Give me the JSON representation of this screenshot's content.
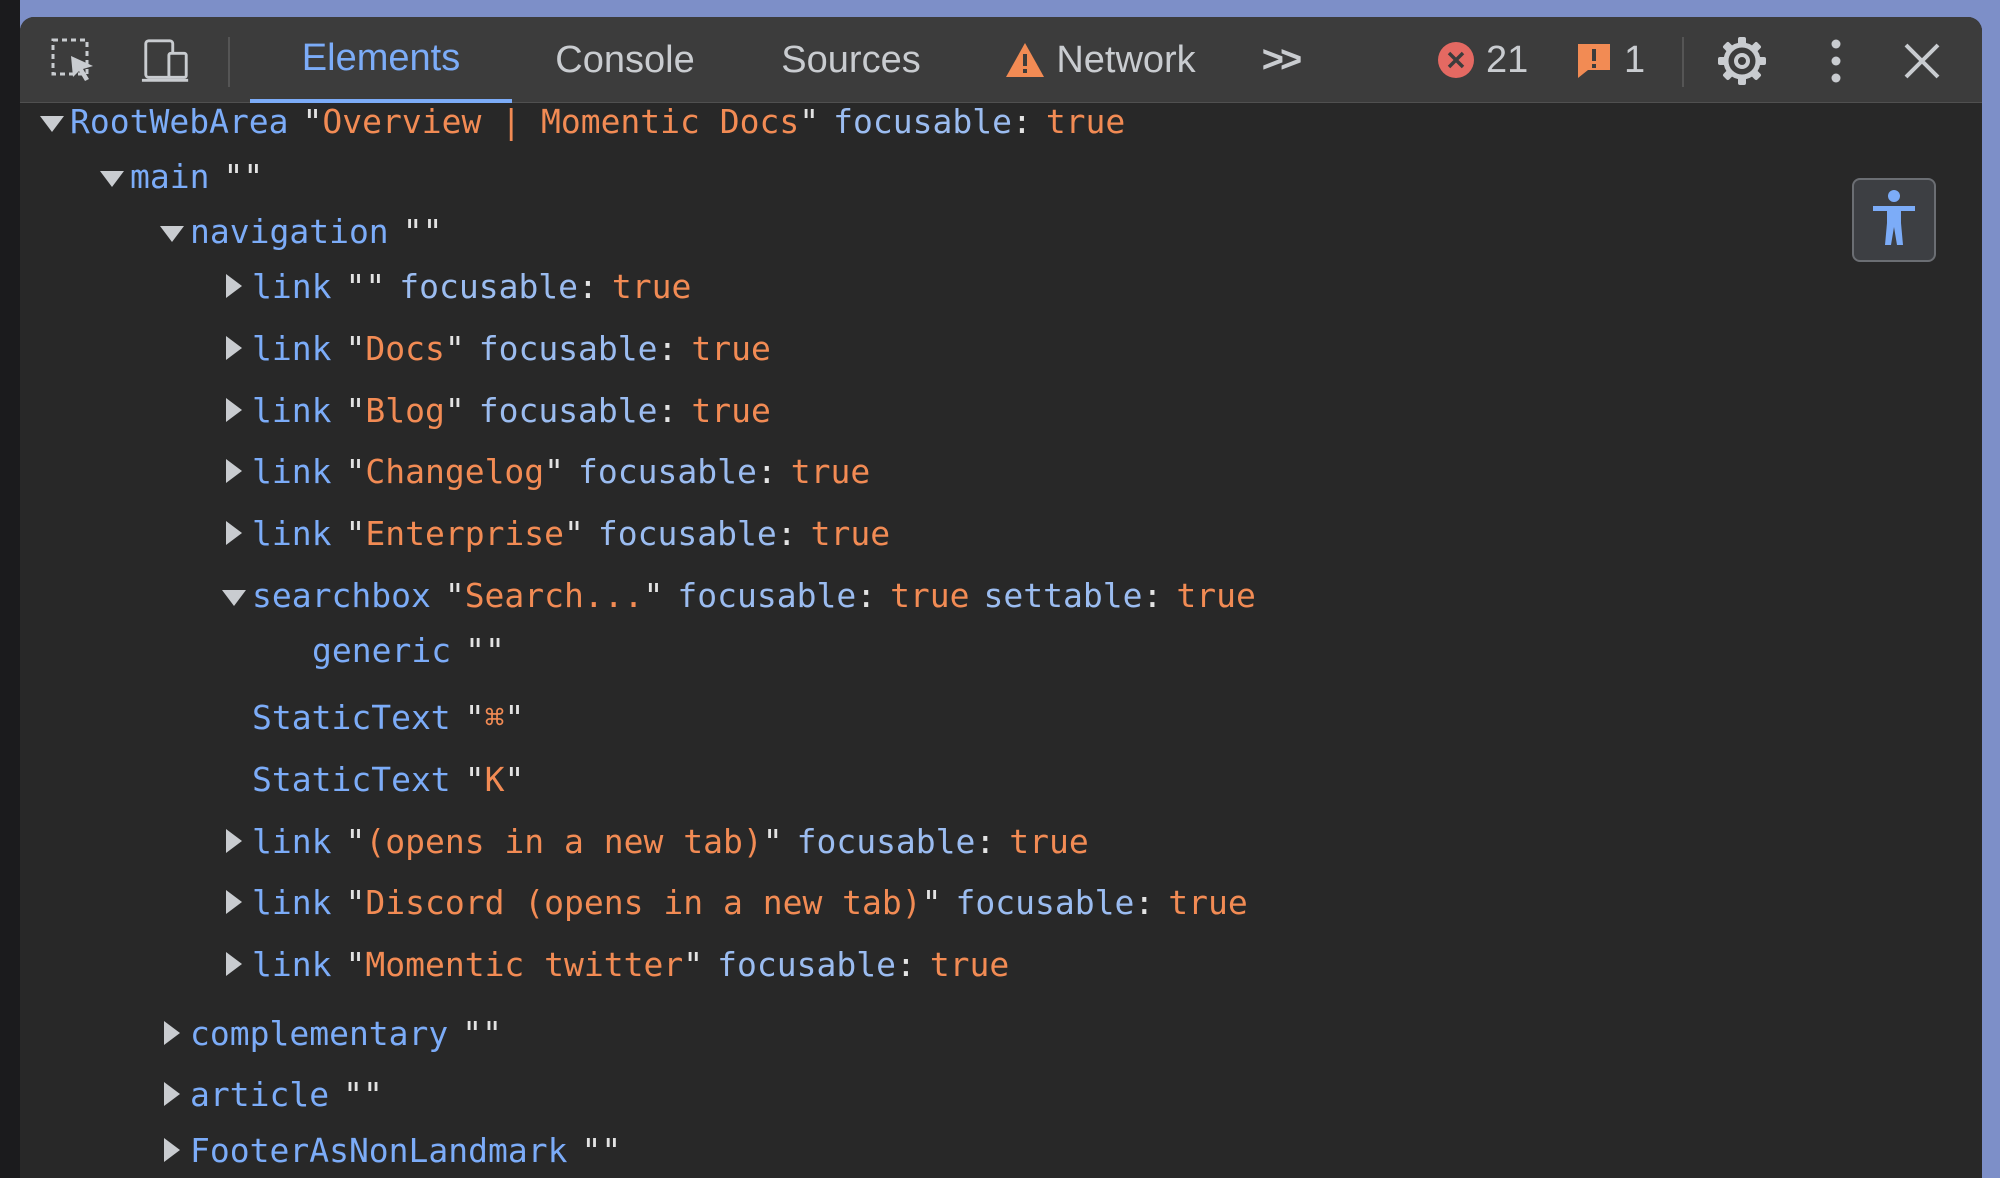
{
  "toolbar": {
    "tabs": [
      {
        "label": "Elements",
        "active": true
      },
      {
        "label": "Console"
      },
      {
        "label": "Sources"
      },
      {
        "label": "Network",
        "icon": "warning-icon"
      }
    ],
    "more_tabs_label": ">>",
    "errors_count": "21",
    "warnings_count": "1",
    "icons": [
      "inspect-element-icon",
      "device-toolbar-icon",
      "gear-icon",
      "more-vertical-icon",
      "close-icon",
      "error-icon",
      "issue-icon",
      "accessibility-icon"
    ]
  },
  "colors": {
    "accent": "#7cacf8",
    "string": "#f28b54",
    "error": "#e46962",
    "warning": "#f28b54",
    "panel_bg": "#282828",
    "toolbar_bg": "#3c3c3c"
  },
  "tree": {
    "rows": [
      {
        "role": "RootWebArea",
        "name": "Overview | Momentic Docs",
        "props": [
          {
            "k": "focusable",
            "v": "true"
          }
        ]
      },
      {
        "role": "main",
        "name": "",
        "props": []
      },
      {
        "role": "navigation",
        "name": "",
        "props": []
      },
      {
        "role": "link",
        "name": "",
        "props": [
          {
            "k": "focusable",
            "v": "true"
          }
        ]
      },
      {
        "role": "link",
        "name": "Docs",
        "props": [
          {
            "k": "focusable",
            "v": "true"
          }
        ]
      },
      {
        "role": "link",
        "name": "Blog",
        "props": [
          {
            "k": "focusable",
            "v": "true"
          }
        ]
      },
      {
        "role": "link",
        "name": "Changelog",
        "props": [
          {
            "k": "focusable",
            "v": "true"
          }
        ]
      },
      {
        "role": "link",
        "name": "Enterprise",
        "props": [
          {
            "k": "focusable",
            "v": "true"
          }
        ]
      },
      {
        "role": "searchbox",
        "name": "Search...",
        "props": [
          {
            "k": "focusable",
            "v": "true"
          },
          {
            "k": "settable",
            "v": "true"
          }
        ]
      },
      {
        "role": "generic",
        "name": "",
        "props": []
      },
      {
        "role": "StaticText",
        "name": "⌘",
        "props": []
      },
      {
        "role": "StaticText",
        "name": "K",
        "props": []
      },
      {
        "role": "link",
        "name": "(opens in a new tab)",
        "props": [
          {
            "k": "focusable",
            "v": "true"
          }
        ]
      },
      {
        "role": "link",
        "name": "Discord (opens in a new tab)",
        "props": [
          {
            "k": "focusable",
            "v": "true"
          }
        ]
      },
      {
        "role": "link",
        "name": "Momentic twitter",
        "props": [
          {
            "k": "focusable",
            "v": "true"
          }
        ]
      },
      {
        "role": "complementary",
        "name": "",
        "props": []
      },
      {
        "role": "article",
        "name": "",
        "props": []
      },
      {
        "role": "FooterAsNonLandmark",
        "name": "",
        "props": []
      }
    ]
  }
}
